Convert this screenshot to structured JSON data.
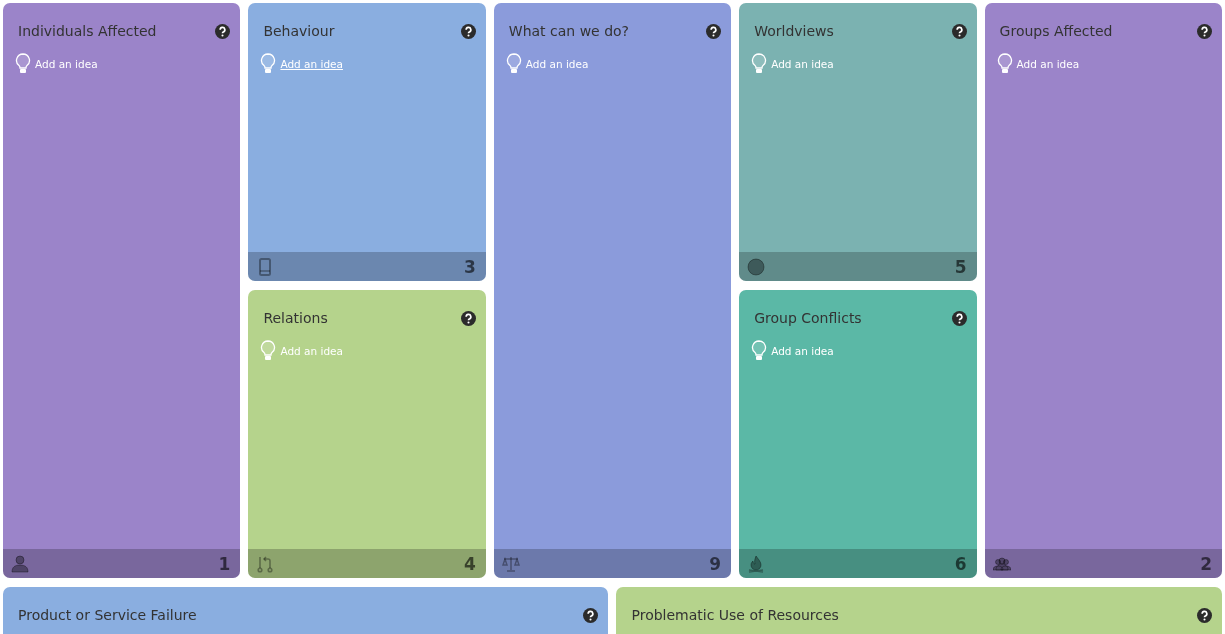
{
  "cards": [
    {
      "title": "Individuals Affected",
      "idea": "Add an idea",
      "idea_underlined": false,
      "count": "1",
      "color": "#9b84c9"
    },
    {
      "title": "Behaviour",
      "idea": "Add an idea",
      "idea_underlined": true,
      "count": "3",
      "color": "#8aaee0"
    },
    {
      "title": "Relations",
      "idea": "Add an idea",
      "idea_underlined": false,
      "count": "4",
      "color": "#b5d38c"
    },
    {
      "title": "What can we do?",
      "idea": "Add an idea",
      "idea_underlined": false,
      "count": "9",
      "color": "#8b9bdb"
    },
    {
      "title": "Worldviews",
      "idea": "Add an idea",
      "idea_underlined": false,
      "count": "5",
      "color": "#7bb2b1"
    },
    {
      "title": "Group Conflicts",
      "idea": "Add an idea",
      "idea_underlined": false,
      "count": "6",
      "color": "#5bb8a6"
    },
    {
      "title": "Groups Affected",
      "idea": "Add an idea",
      "idea_underlined": false,
      "count": "2",
      "color": "#9b84c9"
    },
    {
      "title": "Product or Service Failure",
      "color": "#8aaee0"
    },
    {
      "title": "Problematic Use of Resources",
      "color": "#b5d38c"
    }
  ]
}
